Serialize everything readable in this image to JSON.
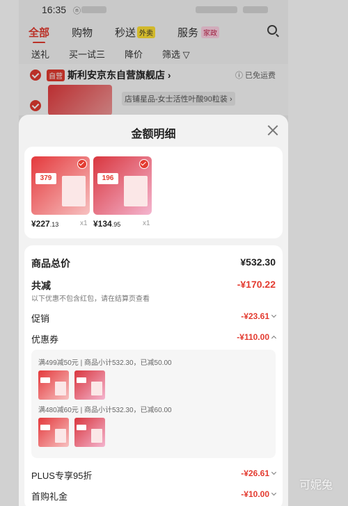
{
  "status_bar": {
    "time": "16:35",
    "indicator": "ⓝ"
  },
  "cart_tabs": [
    {
      "label": "全部",
      "active": true
    },
    {
      "label": "购物",
      "active": false
    },
    {
      "label": "秒送",
      "badge": "外卖",
      "active": false
    },
    {
      "label": "服务",
      "badge": "家政",
      "active": false
    }
  ],
  "filters": [
    "送礼",
    "买一试三",
    "降价",
    "筛选 ▽"
  ],
  "store": {
    "tag": "自营",
    "name": "斯利安京东自营旗舰店 ›",
    "shipping": "ⓘ 已免运费",
    "product_title": "店铺星品-女士活性叶酸90粒装 ›"
  },
  "sheet": {
    "title": "金额明细",
    "products": [
      {
        "price_main": "¥227",
        "price_decimal": ".13",
        "qty": "x1",
        "badge": "379",
        "color_from": "#e4393c",
        "color_to": "#f7c1c1"
      },
      {
        "price_main": "¥134",
        "price_decimal": ".95",
        "qty": "x1",
        "badge": "196",
        "color_from": "#d9363e",
        "color_to": "#f4b5cf"
      }
    ],
    "total": {
      "label": "商品总价",
      "value": "¥532.30"
    },
    "reduction": {
      "label": "共减",
      "value": "-¥170.22",
      "note": "以下优惠不包含红包，请在结算页查看"
    },
    "promotion": {
      "label": "促销",
      "value": "-¥23.61"
    },
    "coupon": {
      "label": "优惠券",
      "value": "-¥110.00",
      "items": [
        {
          "text": "满499减50元 | 商品小计532.30，已减50.00"
        },
        {
          "text": "满480减60元 | 商品小计532.30，已减60.00"
        }
      ]
    },
    "plus": {
      "label": "PLUS专享95折",
      "value": "-¥26.61"
    },
    "first_gift": {
      "label": "首购礼金",
      "value": "-¥10.00"
    }
  },
  "watermark": "可妮兔"
}
